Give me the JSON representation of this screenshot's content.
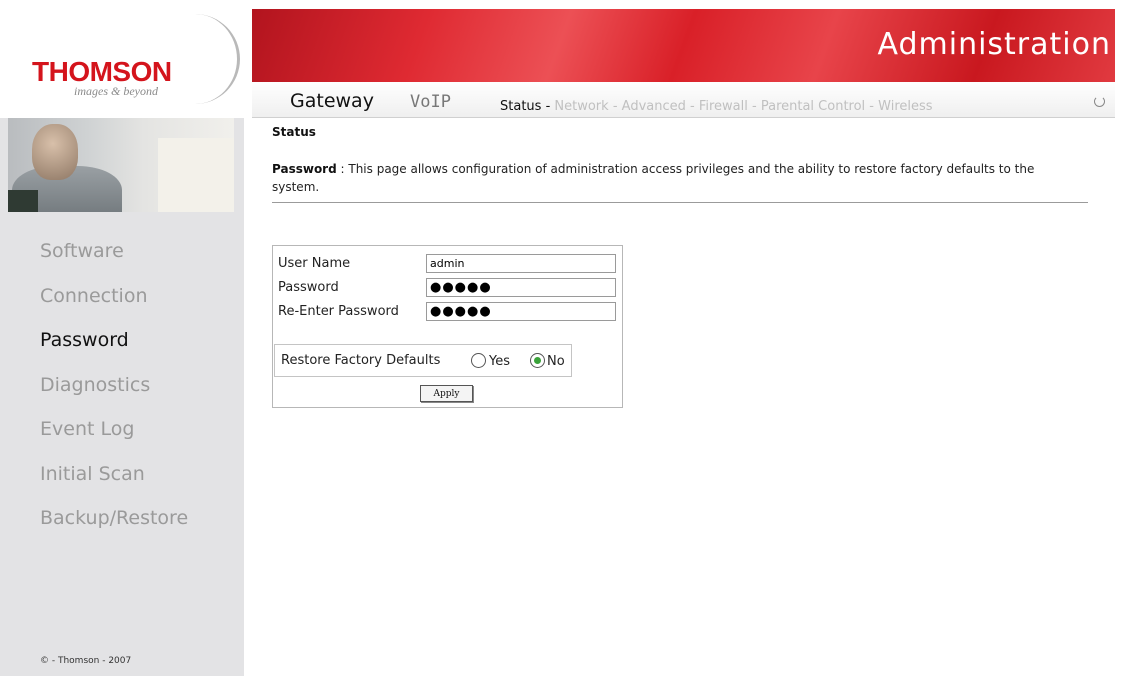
{
  "logo": {
    "name": "THOMSON",
    "tagline": "images & beyond"
  },
  "banner": {
    "title": "Administration"
  },
  "nav": {
    "tabs": [
      {
        "label": "Gateway",
        "active": true
      },
      {
        "label": "VoIP",
        "active": false
      }
    ],
    "sub_items": [
      {
        "label": "Status",
        "active": true
      },
      {
        "label": "Network",
        "active": false
      },
      {
        "label": "Advanced",
        "active": false
      },
      {
        "label": "Firewall",
        "active": false
      },
      {
        "label": "Parental Control",
        "active": false
      },
      {
        "label": "Wireless",
        "active": false
      }
    ],
    "separator": " - "
  },
  "sidebar": {
    "items": [
      {
        "label": "Software",
        "active": false
      },
      {
        "label": "Connection",
        "active": false
      },
      {
        "label": "Password",
        "active": true
      },
      {
        "label": "Diagnostics",
        "active": false
      },
      {
        "label": "Event Log",
        "active": false
      },
      {
        "label": "Initial Scan",
        "active": false
      },
      {
        "label": "Backup/Restore",
        "active": false
      }
    ],
    "copyright": "© - Thomson - 2007"
  },
  "content": {
    "heading": "Status",
    "desc_title": "Password",
    "desc_text": " :  This page allows configuration of administration access privileges and the ability to restore factory defaults to the system."
  },
  "form": {
    "user_name_label": "User Name",
    "user_name_value": "admin",
    "password_label": "Password",
    "password_value": "●●●●●",
    "reenter_label": "Re-Enter Password",
    "reenter_value": "●●●●●",
    "restore_label": "Restore Factory Defaults",
    "restore_yes_label": "Yes",
    "restore_no_label": "No",
    "restore_value": "No",
    "apply_label": "Apply"
  },
  "colors": {
    "brand_red": "#d4141c",
    "sidebar_bg": "#e3e3e5",
    "radio_checked": "#3aa23a"
  }
}
